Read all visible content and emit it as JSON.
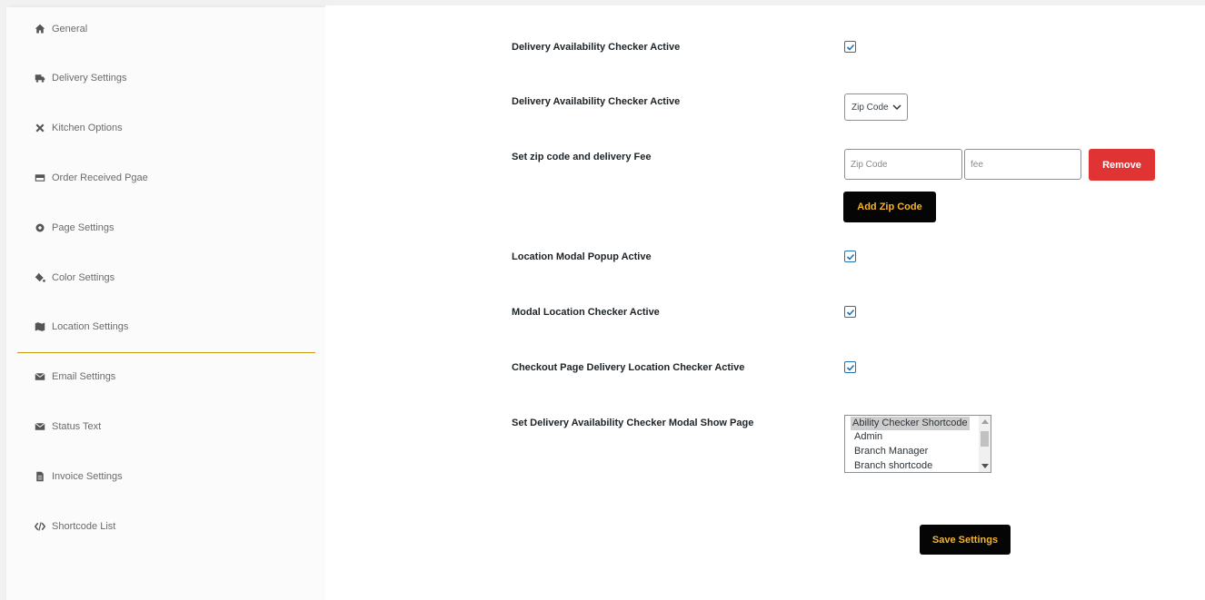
{
  "sidebar": {
    "items": [
      {
        "label": "General",
        "icon": "home-icon"
      },
      {
        "label": "Delivery Settings",
        "icon": "truck-icon"
      },
      {
        "label": "Kitchen Options",
        "icon": "tools-icon"
      },
      {
        "label": "Order Received Pgae",
        "icon": "credit-card-icon"
      },
      {
        "label": "Page Settings",
        "icon": "gear-icon"
      },
      {
        "label": "Color Settings",
        "icon": "paint-bucket-icon"
      },
      {
        "label": "Location Settings",
        "icon": "map-icon"
      },
      {
        "label": "Email Settings",
        "icon": "envelope-icon"
      },
      {
        "label": "Status Text",
        "icon": "envelope-icon"
      },
      {
        "label": "Invoice Settings",
        "icon": "file-icon"
      },
      {
        "label": "Shortcode List",
        "icon": "code-icon"
      }
    ],
    "active_underline_color": "#c79a12"
  },
  "settings": {
    "delivery_checker_active": {
      "label": "Delivery Availability Checker Active",
      "checked": true
    },
    "delivery_checker_type": {
      "label": "Delivery Availability Checker Active",
      "selected": "Zip Code"
    },
    "zip_fee": {
      "label": "Set zip code and delivery Fee",
      "zip_placeholder": "Zip Code",
      "fee_placeholder": "fee",
      "remove_label": "Remove",
      "add_label": "Add Zip Code"
    },
    "location_modal_popup": {
      "label": "Location Modal Popup Active",
      "checked": true
    },
    "modal_location_checker": {
      "label": "Modal Location Checker Active",
      "checked": true
    },
    "checkout_location_checker": {
      "label": "Checkout Page Delivery Location Checker Active",
      "checked": true
    },
    "modal_show_page": {
      "label": "Set Delivery Availability Checker Modal Show Page",
      "options": [
        "Ability Checker Shortcode",
        "Admin",
        "Branch Manager",
        "Branch shortcode"
      ],
      "selected": "Ability Checker Shortcode"
    }
  },
  "save_label": "Save Settings",
  "colors": {
    "remove_button": "#e03333",
    "dark_button": "#050505",
    "dark_button_text": "#f5b52a",
    "checkbox": "#2271b1"
  }
}
